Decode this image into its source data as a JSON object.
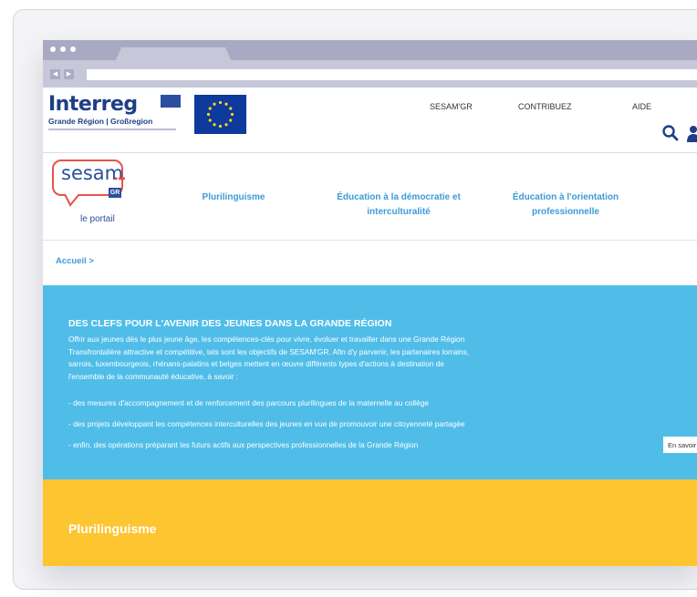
{
  "header": {
    "interreg_logo": "Interreg",
    "interreg_subtitle": "Grande Région | Großregion",
    "top_links": [
      "SESAM'GR",
      "CONTRIBUEZ",
      "AIDE"
    ],
    "icons": [
      "search-icon",
      "user-icon"
    ]
  },
  "nav": {
    "logo": {
      "word": "sesam",
      "badge": "GR",
      "tagline": "le portail"
    },
    "items": [
      {
        "line1": "Plurilinguisme",
        "line2": ""
      },
      {
        "line1": "Éducation à la démocratie et",
        "line2": "interculturalité"
      },
      {
        "line1": "Éducation à l'orientation",
        "line2": "professionnelle"
      }
    ]
  },
  "breadcrumb": {
    "home": "Accueil >"
  },
  "intro": {
    "title": "DES CLEFS POUR L'AVENIR DES JEUNES DANS LA GRANDE RÉGION",
    "lines": [
      "Offrir aux jeunes dès le plus jeune âge, les compétences-clés pour vivre, évoluer et travailler dans une Grande Région",
      "Transfrontalière attractive et compétitive, tels sont les objectifs de SESAM'GR. Afin d'y parvenir, les partenaires lorrains,",
      "sarrois, luxembourgeois, rhénans-palatins et belges mettent en œuvre différents types d'actions à destination de",
      "l'ensemble de la communauté éducative, à savoir :"
    ],
    "bullets": [
      "- des mesures d'accompagnement et de renforcement des parcours plurilingues de la maternelle au collège",
      "- des projets développant les compétences interculturelles des jeunes en vue de promouvoir une citoyenneté partagée",
      "- enfin, des opérations préparant les futurs actifs aux perspectives professionnelles de la Grande Région"
    ],
    "more_button": "En savoir plus"
  },
  "section": {
    "title": "Plurilinguisme"
  },
  "colors": {
    "brand_blue": "#1e3f87",
    "accent_blue": "#3d9bd8",
    "intro_bg": "#50bde9",
    "section_yellow": "#fdc530",
    "sesam_red": "#e8534a",
    "browser_chrome": "#a9a9c4"
  }
}
